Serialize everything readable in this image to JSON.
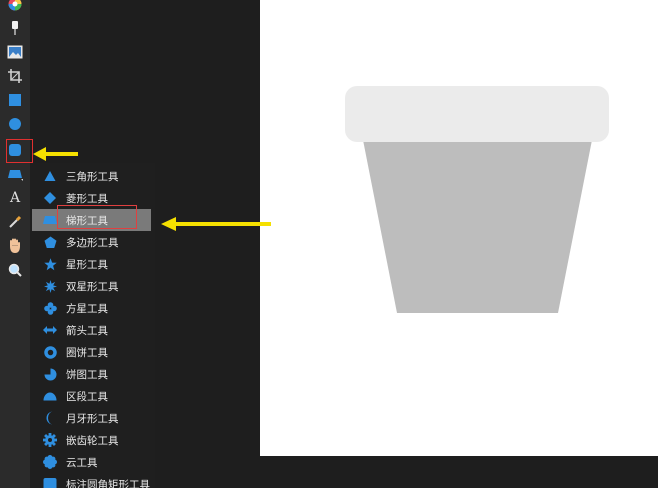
{
  "toolbar": {
    "tools": [
      {
        "icon": "color-wheel-icon"
      },
      {
        "icon": "brush-icon"
      },
      {
        "icon": "image-icon"
      },
      {
        "icon": "crop-icon"
      },
      {
        "icon": "rectangle-icon"
      },
      {
        "icon": "ellipse-icon"
      },
      {
        "icon": "shape-tool-icon"
      },
      {
        "icon": "trapezoid-icon"
      },
      {
        "icon": "text-tool-icon",
        "label": "A"
      },
      {
        "icon": "eyedropper-icon"
      },
      {
        "icon": "hand-icon"
      },
      {
        "icon": "zoom-icon"
      }
    ]
  },
  "flyout": {
    "items": [
      {
        "label": "三角形工具",
        "icon": "triangle-icon"
      },
      {
        "label": "菱形工具",
        "icon": "diamond-icon"
      },
      {
        "label": "梯形工具",
        "icon": "trapezoid-icon",
        "selected": true
      },
      {
        "label": "多边形工具",
        "icon": "polygon-icon"
      },
      {
        "label": "星形工具",
        "icon": "star-icon"
      },
      {
        "label": "双星形工具",
        "icon": "double-star-icon"
      },
      {
        "label": "方星工具",
        "icon": "square-star-icon"
      },
      {
        "label": "箭头工具",
        "icon": "arrow-icon"
      },
      {
        "label": "圈饼工具",
        "icon": "donut-icon"
      },
      {
        "label": "饼图工具",
        "icon": "pie-icon"
      },
      {
        "label": "区段工具",
        "icon": "segment-icon"
      },
      {
        "label": "月牙形工具",
        "icon": "crescent-icon"
      },
      {
        "label": "嵌齿轮工具",
        "icon": "cog-icon"
      },
      {
        "label": "云工具",
        "icon": "cloud-icon"
      },
      {
        "label": "标注圆角矩形工具",
        "icon": "callout-icon"
      }
    ]
  },
  "colors": {
    "accent": "#2f8fe0",
    "arrow": "#f5e000",
    "highlight_border": "#e03030",
    "pot_rim": "#ebebeb",
    "pot_body": "#bdbdbd"
  }
}
